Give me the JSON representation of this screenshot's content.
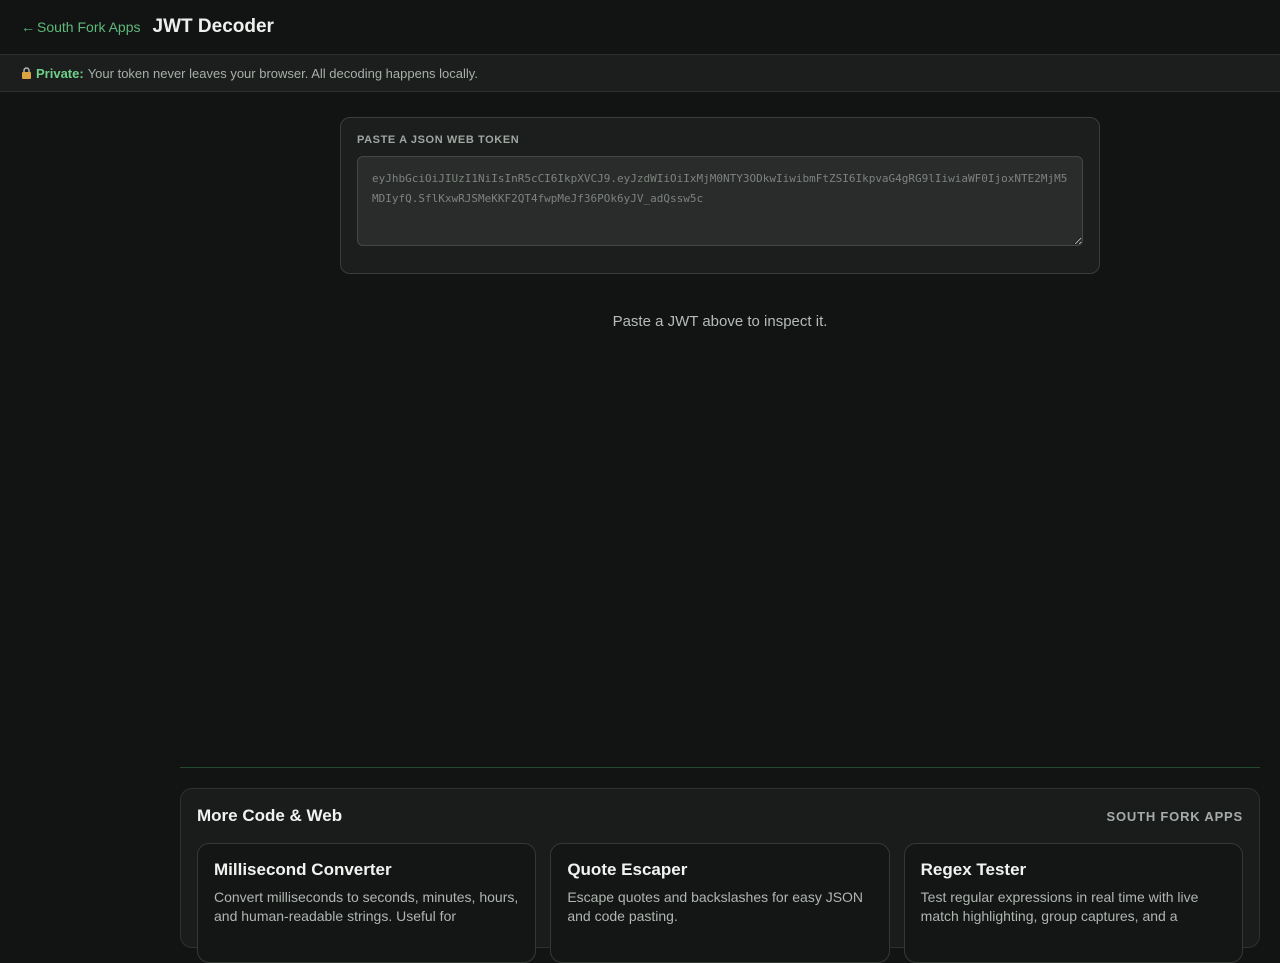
{
  "header": {
    "back_label": "South Fork Apps",
    "title": "JWT Decoder"
  },
  "privacy": {
    "label": "Private:",
    "message": "Your token never leaves your browser. All decoding happens locally."
  },
  "token": {
    "label": "PASTE A JSON WEB TOKEN",
    "value": "",
    "placeholder": "eyJhbGciOiJIUzI1NiIsInR5cCI6IkpXVCJ9.eyJzdWIiOiIxMjM0NTY3ODkwIiwibmFtZSI6IkpvaG4gRG9lIiwiaWF0IjoxNTE2MjM5MDIyfQ.SflKxwRJSMeKKF2QT4fwpMeJf36POk6yJV_adQssw5c"
  },
  "empty_state": "Paste a JWT above to inspect it.",
  "more": {
    "title": "More Code & Web",
    "brand": "SOUTH FORK APPS",
    "cards": [
      {
        "title": "Millisecond Converter",
        "desc": "Convert milliseconds to seconds, minutes, hours, and human-readable strings. Useful for"
      },
      {
        "title": "Quote Escaper",
        "desc": "Escape quotes and backslashes for easy JSON and code pasting."
      },
      {
        "title": "Regex Tester",
        "desc": "Test regular expressions in real time with live match highlighting, group captures, and a"
      }
    ]
  },
  "colors": {
    "background": "#121414",
    "accent": "#5fb87a",
    "private_green": "#6fd08a"
  }
}
